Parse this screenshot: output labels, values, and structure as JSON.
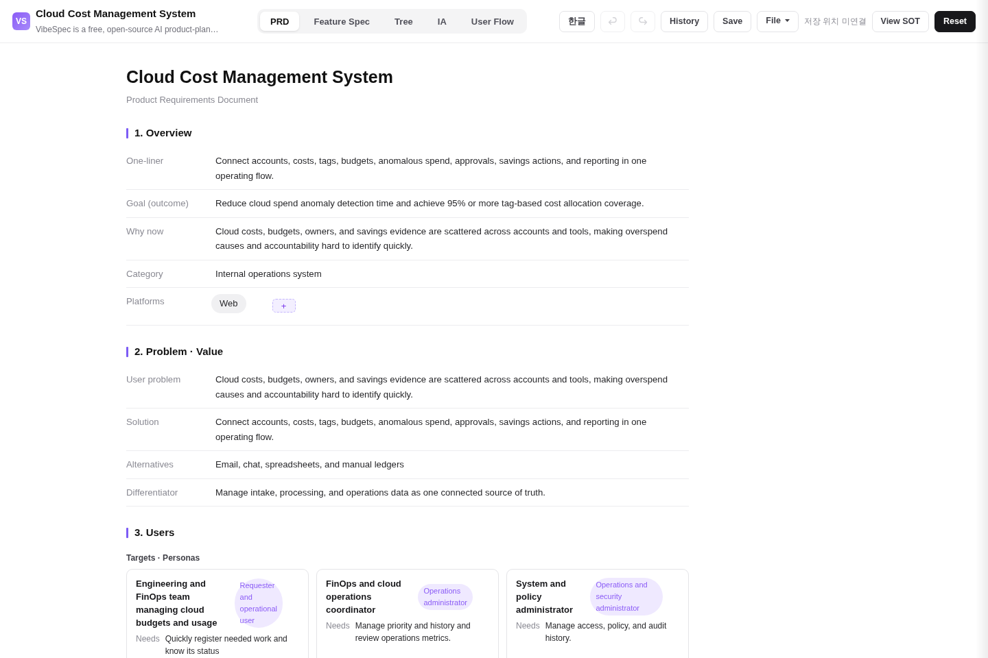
{
  "app": {
    "logo": "VS",
    "title": "Cloud Cost Management System",
    "subtitle": "VibeSpec is a free, open-source AI product-plan…"
  },
  "tabs": [
    {
      "label": "PRD",
      "selected": true
    },
    {
      "label": "Feature Spec",
      "selected": false
    },
    {
      "label": "Tree",
      "selected": false
    },
    {
      "label": "IA",
      "selected": false
    },
    {
      "label": "User Flow",
      "selected": false
    }
  ],
  "toolbar": [
    {
      "kind": "button",
      "label": "한글",
      "disabled": false
    },
    {
      "kind": "undo",
      "disabled": true
    },
    {
      "kind": "redo",
      "disabled": true
    },
    {
      "kind": "button",
      "label": "History",
      "disabled": false
    },
    {
      "kind": "button",
      "label": "Save",
      "disabled": false
    },
    {
      "kind": "menu",
      "label": "File",
      "disabled": false
    },
    {
      "kind": "status",
      "label": "저장 위치 미연결",
      "disabled": false
    },
    {
      "kind": "button",
      "label": "View SOT",
      "disabled": false
    },
    {
      "kind": "primary",
      "label": "Reset",
      "disabled": false
    }
  ],
  "document": {
    "title": "Cloud Cost Management System",
    "subtitle": "Product Requirements Document",
    "sections": [
      {
        "heading": "1. Overview",
        "rows": [
          {
            "kind": "text",
            "label": "One-liner",
            "value": "Connect accounts, costs, tags, budgets, anomalous spend, approvals, savings actions, and reporting in one operating flow."
          },
          {
            "kind": "text",
            "label": "Goal (outcome)",
            "value": "Reduce cloud spend anomaly detection time and achieve 95% or more tag-based cost allocation coverage."
          },
          {
            "kind": "text",
            "label": "Why now",
            "value": "Cloud costs, budgets, owners, and savings evidence are scattered across accounts and tools, making overspend causes and accountability hard to identify quickly."
          },
          {
            "kind": "text",
            "label": "Category",
            "value": "Internal operations system"
          },
          {
            "kind": "chips",
            "label": "Platforms",
            "chips": [
              "Web"
            ],
            "add": "+"
          }
        ]
      },
      {
        "heading": "2. Problem · Value",
        "rows": [
          {
            "kind": "text",
            "label": "User problem",
            "value": "Cloud costs, budgets, owners, and savings evidence are scattered across accounts and tools, making overspend causes and accountability hard to identify quickly."
          },
          {
            "kind": "text",
            "label": "Solution",
            "value": "Connect accounts, costs, tags, budgets, anomalous spend, approvals, savings actions, and reporting in one operating flow."
          },
          {
            "kind": "text",
            "label": "Alternatives",
            "value": "Email, chat, spreadsheets, and manual ledgers"
          },
          {
            "kind": "text",
            "label": "Differentiator",
            "value": "Manage intake, processing, and operations data as one connected source of truth."
          }
        ]
      },
      {
        "heading": "3. Users",
        "subheading": "Targets · Personas",
        "personas": [
          {
            "name": "Engineering and FinOps team managing cloud budgets and usage",
            "role": "Requester and operational user",
            "fields": [
              {
                "label": "Needs",
                "value": "Quickly register needed work and know its status"
              }
            ]
          },
          {
            "name": "FinOps and cloud operations coordinator",
            "role": "Operations administrator",
            "fields": [
              {
                "label": "Needs",
                "value": "Manage priority and history and review operations metrics."
              }
            ]
          },
          {
            "name": "System and policy administrator",
            "role": "Operations and security administrator",
            "fields": [
              {
                "label": "Needs",
                "value": "Manage access, policy, and audit history."
              }
            ]
          }
        ]
      }
    ]
  }
}
